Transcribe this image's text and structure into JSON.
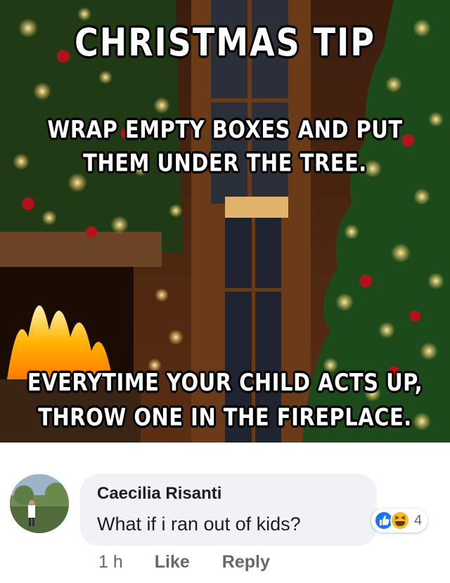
{
  "meme": {
    "title": "CHRISTMAS TIP",
    "top_text": [
      "WRAP EMPTY BOXES AND PUT",
      "THEM UNDER THE TREE."
    ],
    "bottom_text": [
      "EVERYTIME YOUR CHILD ACTS UP,",
      "THROW ONE IN THE FIREPLACE."
    ]
  },
  "comment": {
    "author": "Caecilia Risanti",
    "text": "What if i ran out of kids?",
    "reactions": {
      "icons": [
        "like-icon",
        "haha-icon"
      ],
      "count": "4"
    },
    "time": "1 h",
    "actions": [
      "Like",
      "Reply"
    ]
  },
  "colors": {
    "bubble_bg": "#f0f2f5",
    "meta_text": "#65676b",
    "like_blue": "#1877f2",
    "haha_yellow": "#f7b928"
  }
}
